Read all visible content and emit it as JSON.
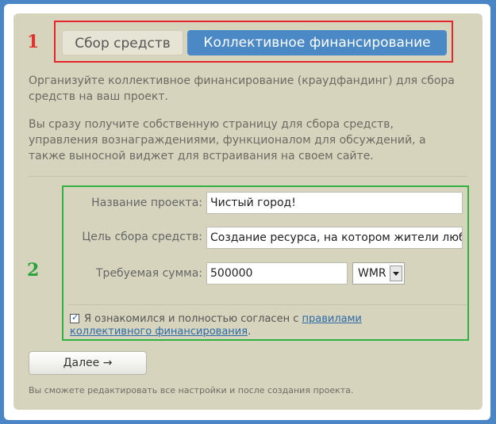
{
  "tabs": [
    {
      "label": "Сбор средств",
      "active": false
    },
    {
      "label": "Коллективное финансирование",
      "active": true
    }
  ],
  "annotations": {
    "step1": "1",
    "step2": "2"
  },
  "description": {
    "p1": "Организуйте коллективное финансирование (краудфандинг) для сбора средств на ваш проект.",
    "p2": "Вы сразу получите собственную страницу для сбора средств, управления вознаграждениями, функционалом для обсуждений, а также выносной виджет для встраивания на своем сайте."
  },
  "form": {
    "project_name_label": "Название проекта:",
    "project_name_value": "Чистый город!",
    "goal_label": "Цель сбора средств:",
    "goal_value": "Создание ресурса, на котором жители любого г",
    "amount_label": "Требуемая сумма:",
    "amount_value": "500000",
    "currency_value": "WMR",
    "agree_text": "Я ознакомился и полностью согласен с ",
    "agree_link": "правилами коллективного финансирования",
    "agree_end": "."
  },
  "actions": {
    "next_label": "Далее →"
  },
  "footnote": "Вы сможете редактировать все настройки и после создания проекта.",
  "colors": {
    "accent": "#4a88c6",
    "panel": "#d6d4bd",
    "highlight_red": "#e4262c",
    "highlight_green": "#2fb240"
  }
}
